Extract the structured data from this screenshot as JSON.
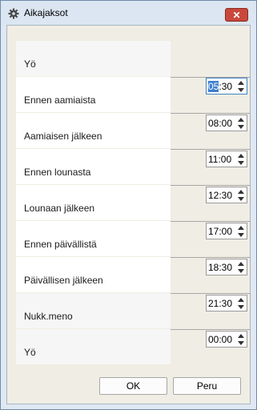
{
  "window": {
    "title": "Aikajaksot",
    "icon": "gear-icon",
    "close_label": "✕"
  },
  "rows": [
    {
      "label": "Yö",
      "time": null
    },
    {
      "label": "Ennen aamiaista",
      "time": "05:30",
      "selected_part": "05",
      "rest": ":30"
    },
    {
      "label": "Aamiaisen jälkeen",
      "time": "08:00"
    },
    {
      "label": "Ennen lounasta",
      "time": "11:00"
    },
    {
      "label": "Lounaan jälkeen",
      "time": "12:30"
    },
    {
      "label": "Ennen päivällistä",
      "time": "17:00"
    },
    {
      "label": "Päivällisen jälkeen",
      "time": "18:30"
    },
    {
      "label": "Nukk.meno",
      "time": "21:30"
    },
    {
      "label": "Yö",
      "time": "00:00"
    }
  ],
  "buttons": {
    "ok": "OK",
    "cancel": "Peru"
  }
}
